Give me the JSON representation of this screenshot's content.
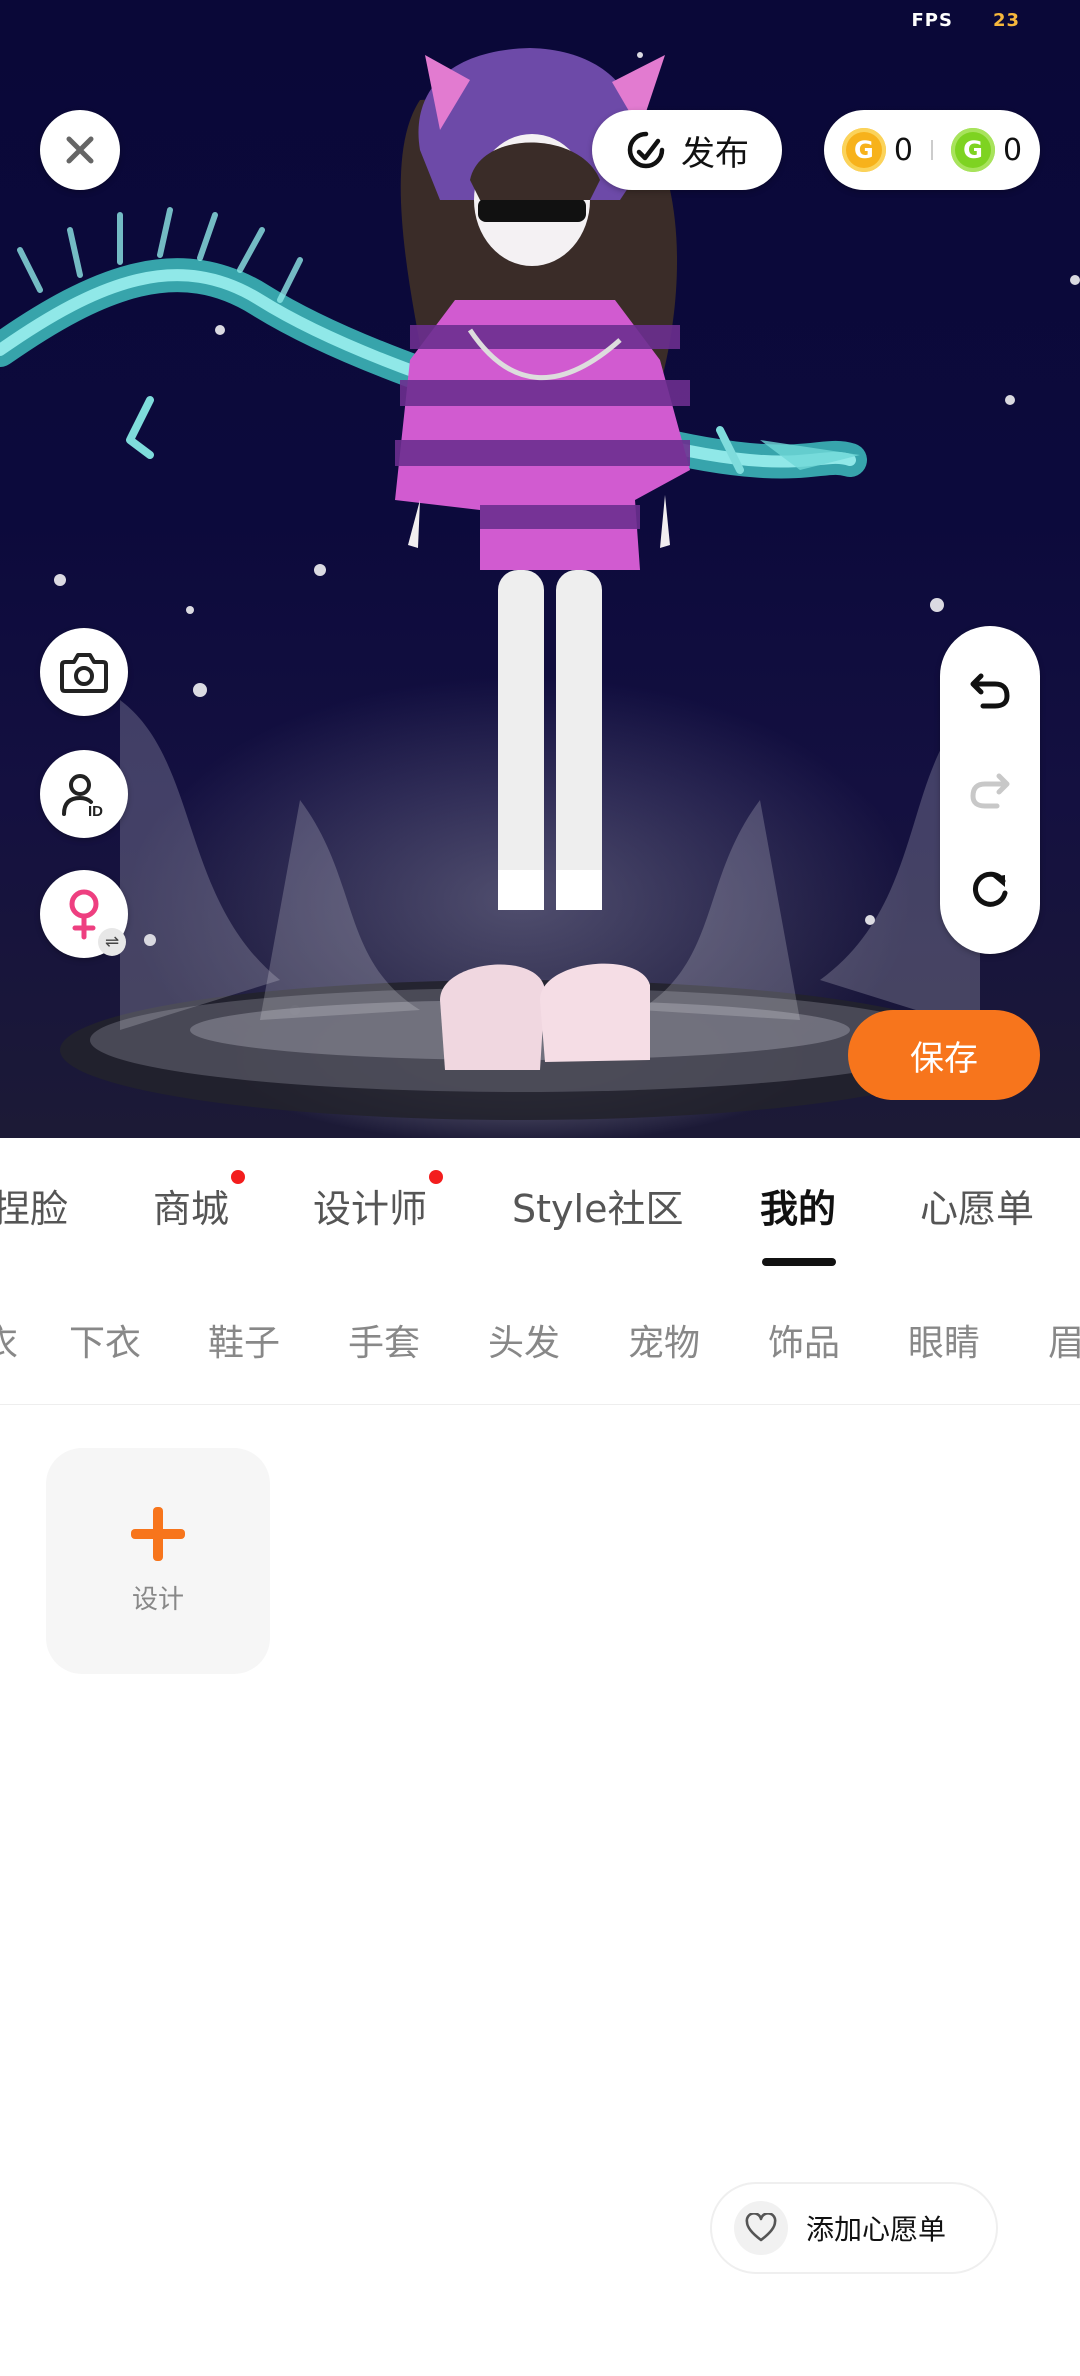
{
  "hud": {
    "fps_label": "FPS",
    "fps_value": "23"
  },
  "toolbar": {
    "publish_label": "发布",
    "coins": [
      {
        "icon": "gold-coin-icon",
        "value": "0"
      },
      {
        "icon": "green-coin-icon",
        "value": "0"
      }
    ],
    "save_label": "保存"
  },
  "tabs": [
    {
      "label": "捏脸",
      "active": false,
      "dot": false
    },
    {
      "label": "商城",
      "active": false,
      "dot": true
    },
    {
      "label": "设计师",
      "active": false,
      "dot": true
    },
    {
      "label": "Style社区",
      "active": false,
      "dot": false
    },
    {
      "label": "我的",
      "active": true,
      "dot": false
    },
    {
      "label": "心愿单",
      "active": false,
      "dot": false
    }
  ],
  "subtabs": [
    "衣",
    "下衣",
    "鞋子",
    "手套",
    "头发",
    "宠物",
    "饰品",
    "眼睛",
    "眉"
  ],
  "content": {
    "design_label": "设计"
  },
  "wishlist": {
    "label": "添加心愿单"
  },
  "colors": {
    "accent": "#f7751c",
    "dot": "#f31d1d",
    "scene_bg": "#0a0838"
  }
}
